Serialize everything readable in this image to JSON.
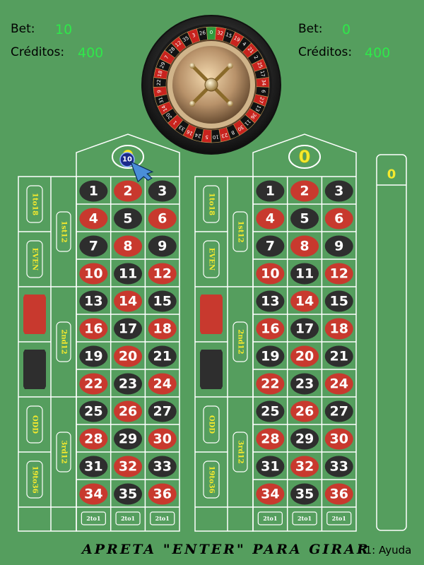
{
  "left_stats": {
    "bet_label": "Bet:",
    "bet_value": "10",
    "credits_label": "Créditos:",
    "credits_value": "400"
  },
  "right_stats": {
    "bet_label": "Bet:",
    "bet_value": "0",
    "credits_label": "Créditos:",
    "credits_value": "400"
  },
  "colors": {
    "felt": "#559e5e",
    "red": "#c8392e",
    "black": "#2e2e2e",
    "line": "#ffffff",
    "label": "#f5e92e",
    "credit": "#2fe84a"
  },
  "wheel": {
    "sequence": [
      "0",
      "32",
      "15",
      "19",
      "4",
      "21",
      "2",
      "25",
      "17",
      "34",
      "6",
      "27",
      "13",
      "36",
      "11",
      "30",
      "8",
      "23",
      "10",
      "5",
      "24",
      "16",
      "33",
      "1",
      "20",
      "14",
      "31",
      "9",
      "22",
      "18",
      "29",
      "7",
      "28",
      "12",
      "35",
      "3",
      "26"
    ]
  },
  "red_numbers": [
    1,
    3,
    5,
    7,
    9,
    12,
    14,
    16,
    18,
    19,
    21,
    23,
    25,
    27,
    30,
    32,
    34,
    36
  ],
  "red_numbers_display": [
    2,
    4,
    6,
    8,
    10,
    12,
    14,
    16,
    18,
    20,
    22,
    24,
    26,
    28,
    30,
    32,
    34,
    36
  ],
  "tables": [
    {
      "zero_label": "0",
      "chip_label": "10",
      "has_chip": true
    },
    {
      "zero_label": "0",
      "chip_label": "",
      "has_chip": false
    }
  ],
  "outside_labels": {
    "low": "1to18",
    "even": "EVEN",
    "odd": "ODD",
    "high": "19to36",
    "dozen1": "1st12",
    "dozen2": "2nd12",
    "dozen3": "3rd12",
    "column": "2to1"
  },
  "side_meter": {
    "value": "0"
  },
  "footer": {
    "instruction": "APRETA \"ENTER\" PARA GIRAR",
    "help": "F1: Ayuda"
  }
}
